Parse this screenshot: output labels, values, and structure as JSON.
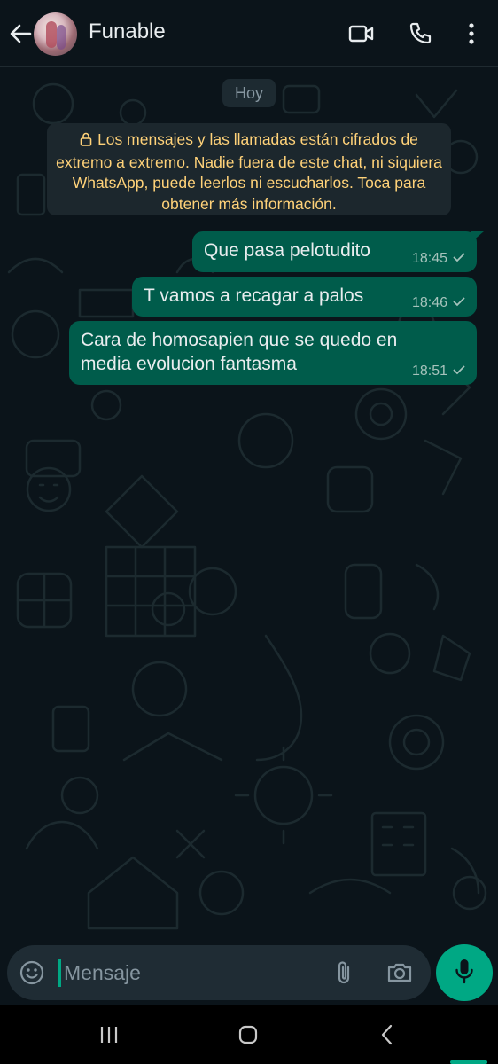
{
  "header": {
    "contact_name": "Funable",
    "icons": [
      "back-arrow-icon",
      "video-call-icon",
      "voice-call-icon",
      "more-vertical-icon"
    ]
  },
  "chat": {
    "day_label": "Hoy",
    "encryption_notice": "Los mensajes y las llamadas están cifrados de extremo a extremo. Nadie fuera de este chat, ni siquiera WhatsApp, puede leerlos ni escucharlos. Toca para obtener más información.",
    "messages": [
      {
        "text_lines": [
          "Que pasa pelotudito"
        ],
        "time": "18:45",
        "status": "sent"
      },
      {
        "text_lines": [
          "T vamos a recagar a palos"
        ],
        "time": "18:46",
        "status": "sent"
      },
      {
        "text_lines": [
          "Cara de homosapien que se quedo en",
          "media evolucion fantasma"
        ],
        "time": "18:51",
        "status": "sent"
      }
    ]
  },
  "composer": {
    "placeholder": "Mensaje",
    "value": ""
  },
  "colors": {
    "background": "#0b141a",
    "outgoing_bubble": "#005c4b",
    "notice_text": "#ffd279",
    "accent": "#00a884"
  }
}
